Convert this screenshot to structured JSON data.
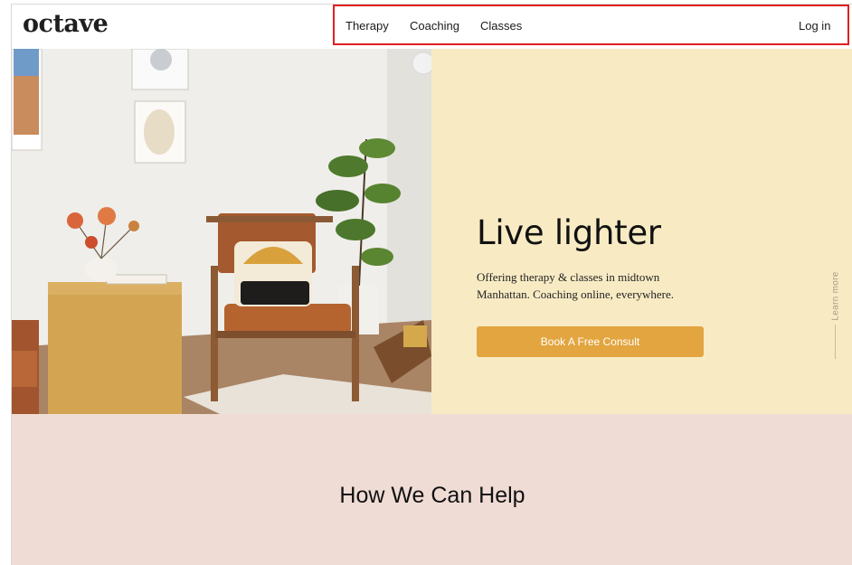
{
  "brand": {
    "logo_text": "octave"
  },
  "nav": {
    "items": [
      {
        "label": "Therapy"
      },
      {
        "label": "Coaching"
      },
      {
        "label": "Classes"
      }
    ],
    "login_label": "Log in"
  },
  "hero": {
    "title": "Live lighter",
    "subtitle": "Offering therapy & classes in midtown Manhattan. Coaching online, everywhere.",
    "cta_label": "Book A Free Consult",
    "learn_more_label": "Learn more"
  },
  "section": {
    "title": "How We Can Help"
  },
  "colors": {
    "accent": "#e3a53f",
    "promo_bg": "#f8ebc4",
    "section_bg": "#efdcd4",
    "highlight": "#e0201f"
  }
}
